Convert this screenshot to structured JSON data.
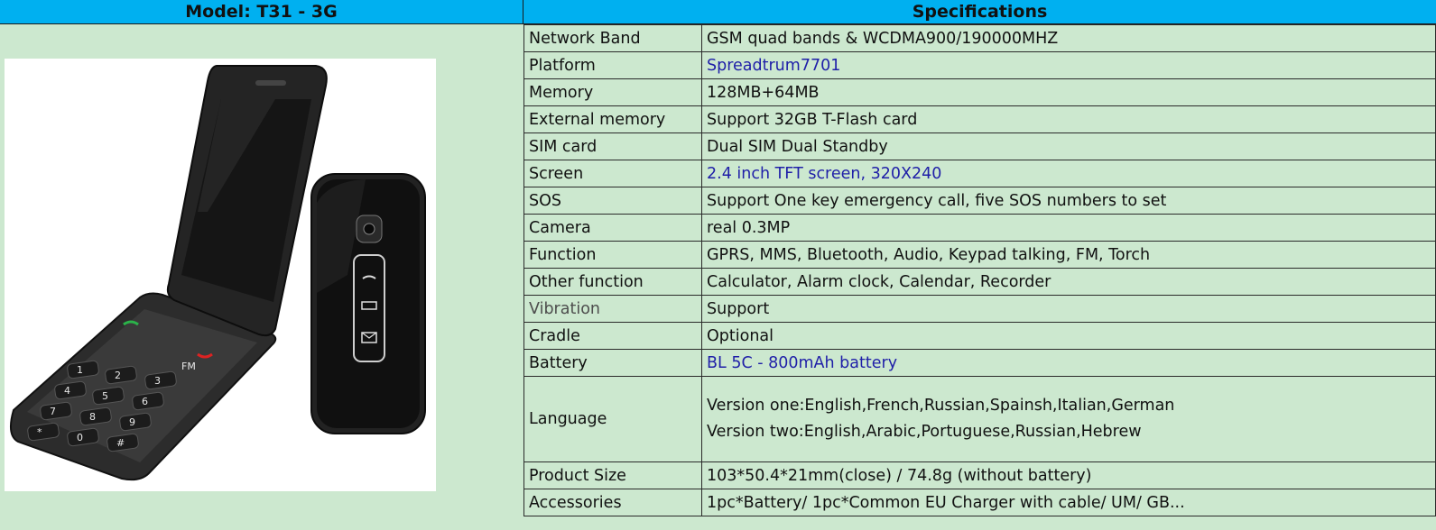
{
  "header": {
    "model_title": "Model: T31 - 3G",
    "specs_title": "Specifications"
  },
  "colors": {
    "header_bg": "#00b0f0",
    "page_bg": "#cce8cf",
    "link_blue": "#1f1fa8"
  },
  "specs": [
    {
      "key": "Network Band",
      "value": "GSM quad bands & WCDMA900/190000MHZ"
    },
    {
      "key": "Platform",
      "value": "Spreadtrum7701"
    },
    {
      "key": "Memory",
      "value": "128MB+64MB"
    },
    {
      "key": "External memory",
      "value": "Support 32GB T-Flash card"
    },
    {
      "key": "SIM card",
      "value": "Dual SIM Dual Standby"
    },
    {
      "key": "Screen",
      "value": "2.4 inch TFT screen, 320X240"
    },
    {
      "key": "SOS",
      "value": "Support One key emergency call, five SOS numbers to set"
    },
    {
      "key": "Camera",
      "value": "real 0.3MP"
    },
    {
      "key": "Function",
      "value": "GPRS, MMS, Bluetooth, Audio, Keypad talking, FM, Torch"
    },
    {
      "key": "Other function",
      "value": "Calculator, Alarm clock, Calendar, Recorder"
    },
    {
      "key": "Vibration",
      "value": "Support"
    },
    {
      "key": "Cradle",
      "value": "Optional"
    },
    {
      "key": "Battery",
      "value": "BL 5C - 800mAh battery"
    },
    {
      "key": "Language",
      "value_line1": "Version one:English,French,Russian,Spainsh,Italian,German",
      "value_line2": "Version two:English,Arabic,Portuguese,Russian,Hebrew"
    },
    {
      "key": "Product Size",
      "value": "103*50.4*21mm(close) / 74.8g (without battery)"
    },
    {
      "key": "Accessories",
      "value": "1pc*Battery/ 1pc*Common EU Charger with cable/ UM/ GB..."
    }
  ],
  "keypad": {
    "keys": [
      "1",
      "2",
      "3",
      "4",
      "5",
      "6",
      "7",
      "8",
      "9",
      "*",
      "0",
      "#"
    ],
    "fm_label": "FM"
  }
}
